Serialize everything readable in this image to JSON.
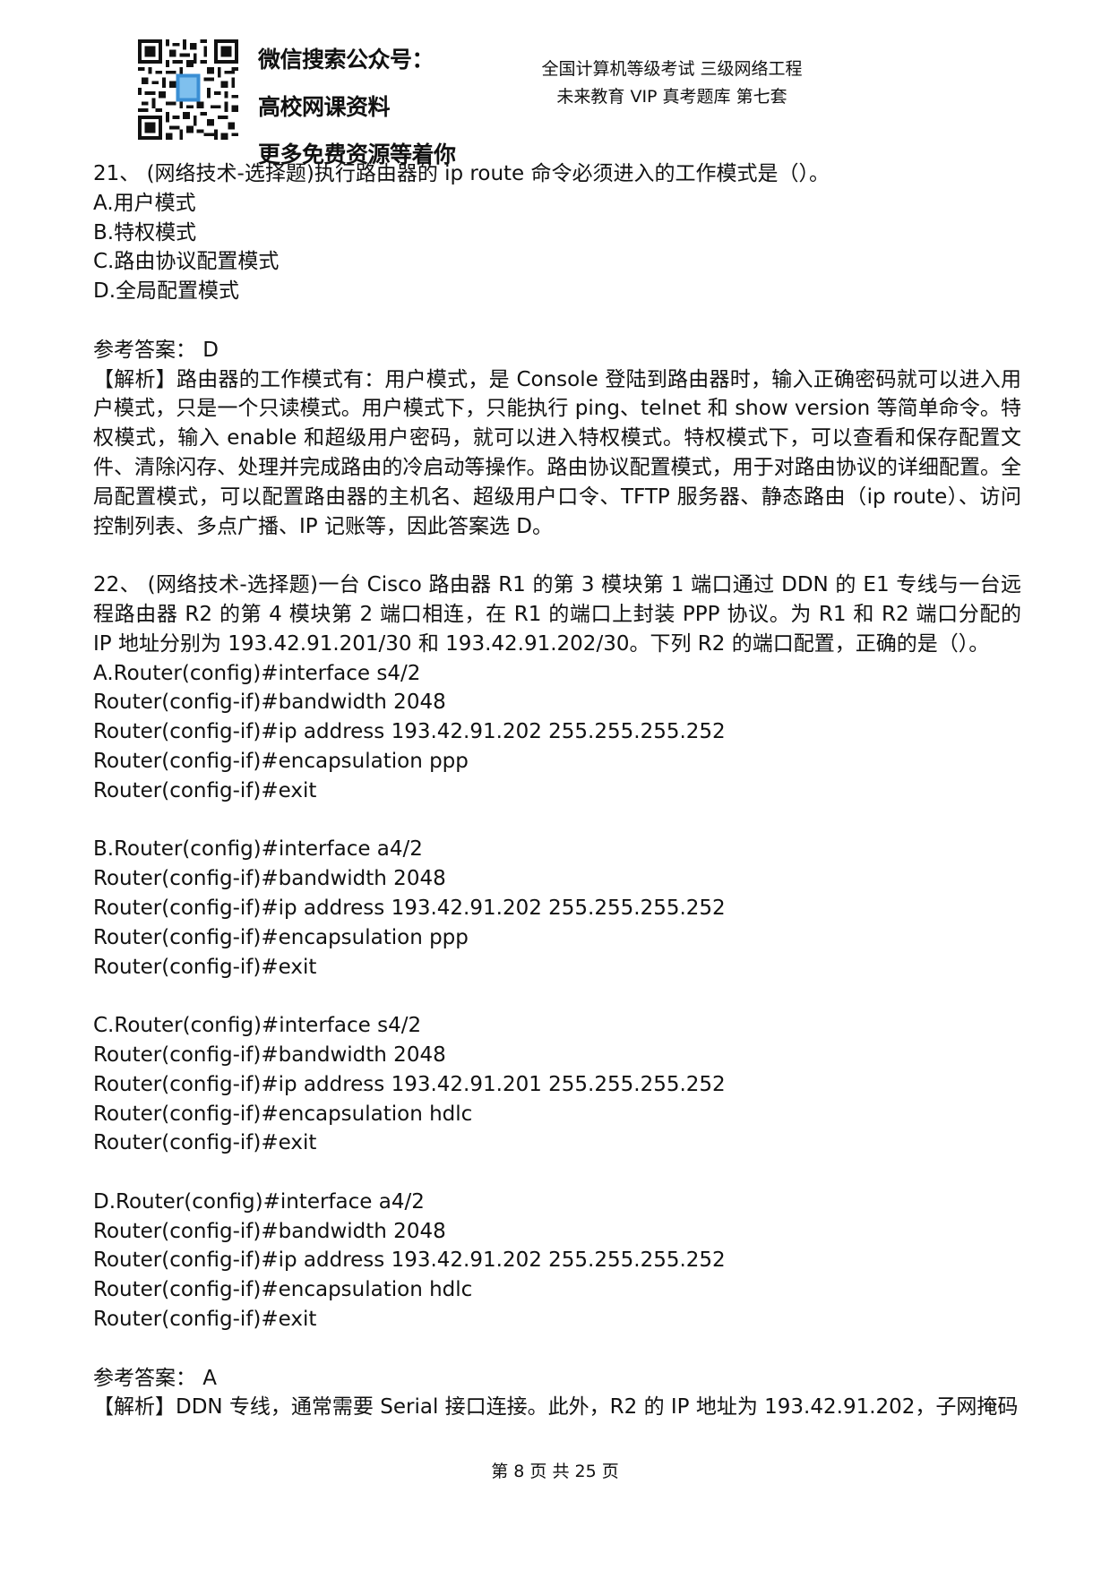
{
  "promo": {
    "line1": "微信搜索公众号：",
    "line2": "高校网课资料",
    "line3": "更多免费资源等着你"
  },
  "header": {
    "line1": "全国计算机等级考试 三级网络工程",
    "line2": "未来教育 VIP 真考题库 第七套"
  },
  "q21": {
    "stem": "21、 (网络技术-选择题)执行路由器的 ip route 命令必须进入的工作模式是（）。",
    "options": [
      "A.用户模式",
      "B.特权模式",
      "C.路由协议配置模式",
      "D.全局配置模式"
    ],
    "answer": "参考答案： D",
    "analysis": "【解析】路由器的工作模式有：用户模式，是 Console 登陆到路由器时，输入正确密码就可以进入用户模式，只是一个只读模式。用户模式下，只能执行 ping、telnet 和 show version 等简单命令。特权模式，输入 enable 和超级用户密码，就可以进入特权模式。特权模式下，可以查看和保存配置文件、清除闪存、处理并完成路由的冷启动等操作。路由协议配置模式，用于对路由协议的详细配置。全局配置模式，可以配置路由器的主机名、超级用户口令、TFTP 服务器、静态路由（ip route）、访问控制列表、多点广播、IP 记账等，因此答案选 D。"
  },
  "q22": {
    "stem": "22、 (网络技术-选择题)一台 Cisco 路由器 R1 的第 3 模块第 1 端口通过 DDN 的 E1 专线与一台远程路由器 R2 的第 4 模块第 2 端口相连，在 R1 的端口上封装 PPP 协议。为 R1 和 R2 端口分配的 IP 地址分别为 193.42.91.201/30 和 193.42.91.202/30。下列 R2 的端口配置，正确的是（）。",
    "options": [
      [
        "A.Router(config)#interface s4/2",
        "Router(config-if)#bandwidth 2048",
        "Router(config-if)#ip address 193.42.91.202 255.255.255.252",
        "Router(config-if)#encapsulation ppp",
        "Router(config-if)#exit"
      ],
      [
        "B.Router(config)#interface a4/2",
        "Router(config-if)#bandwidth 2048",
        "Router(config-if)#ip address 193.42.91.202 255.255.255.252",
        "Router(config-if)#encapsulation ppp",
        "Router(config-if)#exit"
      ],
      [
        "C.Router(config)#interface s4/2",
        "Router(config-if)#bandwidth 2048",
        "Router(config-if)#ip address 193.42.91.201 255.255.255.252",
        "Router(config-if)#encapsulation hdlc",
        "Router(config-if)#exit"
      ],
      [
        "D.Router(config)#interface a4/2",
        "Router(config-if)#bandwidth 2048",
        "Router(config-if)#ip address 193.42.91.202 255.255.255.252",
        "Router(config-if)#encapsulation hdlc",
        "Router(config-if)#exit"
      ]
    ],
    "answer": "参考答案： A",
    "analysis": "【解析】DDN 专线，通常需要 Serial 接口连接。此外，R2 的 IP 地址为 193.42.91.202，子网掩码"
  },
  "footer": "第 8 页 共 25 页"
}
